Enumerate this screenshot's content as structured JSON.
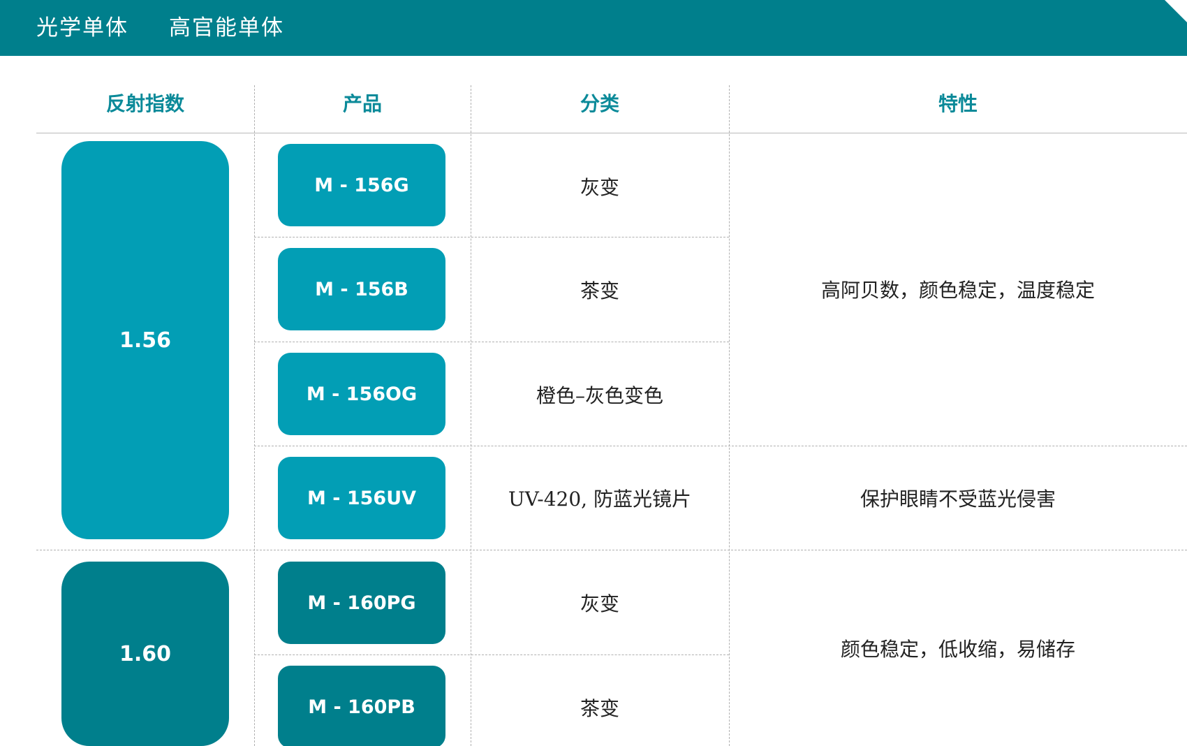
{
  "tabs": {
    "optical": "光学单体",
    "high_performance": "高官能单体"
  },
  "table": {
    "headers": [
      "反射指数",
      "产品",
      "分类",
      "特性"
    ],
    "groups": [
      {
        "index": "1.56",
        "products": [
          {
            "name": "M - 156G",
            "category": "灰变"
          },
          {
            "name": "M - 156B",
            "category": "茶变"
          },
          {
            "name": "M - 156OG",
            "category": "橙色–灰色变色"
          },
          {
            "name": "M - 156UV",
            "category": "UV-420, 防蓝光镜片"
          }
        ],
        "features": [
          "高阿贝数，颜色稳定，温度稳定",
          "保护眼睛不受蓝光侵害"
        ]
      },
      {
        "index": "1.60",
        "products": [
          {
            "name": "M - 160PG",
            "category": "灰变"
          },
          {
            "name": "M - 160PB",
            "category": "茶变"
          }
        ],
        "features": [
          "颜色稳定，低收缩，易储存"
        ]
      }
    ]
  },
  "colors": {
    "header_bg": "#007f8c",
    "accent_light": "#029eb5",
    "accent_dark": "#007f8c",
    "header_text": "#0b8a99"
  }
}
